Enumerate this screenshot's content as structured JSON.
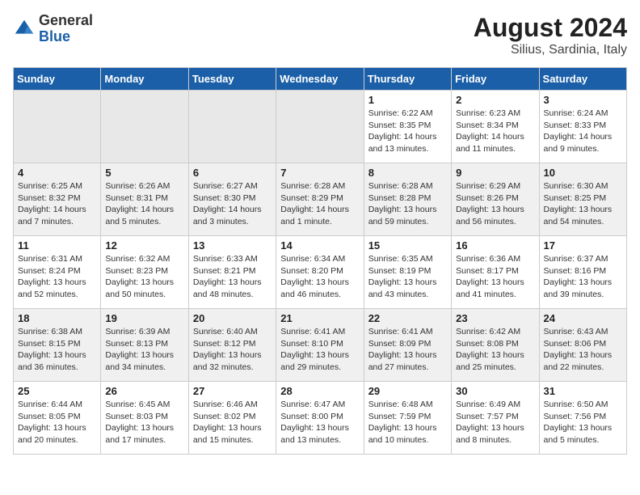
{
  "header": {
    "logo_general": "General",
    "logo_blue": "Blue",
    "month_year": "August 2024",
    "location": "Silius, Sardinia, Italy"
  },
  "weekdays": [
    "Sunday",
    "Monday",
    "Tuesday",
    "Wednesday",
    "Thursday",
    "Friday",
    "Saturday"
  ],
  "weeks": [
    [
      {
        "day": "",
        "info": ""
      },
      {
        "day": "",
        "info": ""
      },
      {
        "day": "",
        "info": ""
      },
      {
        "day": "",
        "info": ""
      },
      {
        "day": "1",
        "info": "Sunrise: 6:22 AM\nSunset: 8:35 PM\nDaylight: 14 hours\nand 13 minutes."
      },
      {
        "day": "2",
        "info": "Sunrise: 6:23 AM\nSunset: 8:34 PM\nDaylight: 14 hours\nand 11 minutes."
      },
      {
        "day": "3",
        "info": "Sunrise: 6:24 AM\nSunset: 8:33 PM\nDaylight: 14 hours\nand 9 minutes."
      }
    ],
    [
      {
        "day": "4",
        "info": "Sunrise: 6:25 AM\nSunset: 8:32 PM\nDaylight: 14 hours\nand 7 minutes."
      },
      {
        "day": "5",
        "info": "Sunrise: 6:26 AM\nSunset: 8:31 PM\nDaylight: 14 hours\nand 5 minutes."
      },
      {
        "day": "6",
        "info": "Sunrise: 6:27 AM\nSunset: 8:30 PM\nDaylight: 14 hours\nand 3 minutes."
      },
      {
        "day": "7",
        "info": "Sunrise: 6:28 AM\nSunset: 8:29 PM\nDaylight: 14 hours\nand 1 minute."
      },
      {
        "day": "8",
        "info": "Sunrise: 6:28 AM\nSunset: 8:28 PM\nDaylight: 13 hours\nand 59 minutes."
      },
      {
        "day": "9",
        "info": "Sunrise: 6:29 AM\nSunset: 8:26 PM\nDaylight: 13 hours\nand 56 minutes."
      },
      {
        "day": "10",
        "info": "Sunrise: 6:30 AM\nSunset: 8:25 PM\nDaylight: 13 hours\nand 54 minutes."
      }
    ],
    [
      {
        "day": "11",
        "info": "Sunrise: 6:31 AM\nSunset: 8:24 PM\nDaylight: 13 hours\nand 52 minutes."
      },
      {
        "day": "12",
        "info": "Sunrise: 6:32 AM\nSunset: 8:23 PM\nDaylight: 13 hours\nand 50 minutes."
      },
      {
        "day": "13",
        "info": "Sunrise: 6:33 AM\nSunset: 8:21 PM\nDaylight: 13 hours\nand 48 minutes."
      },
      {
        "day": "14",
        "info": "Sunrise: 6:34 AM\nSunset: 8:20 PM\nDaylight: 13 hours\nand 46 minutes."
      },
      {
        "day": "15",
        "info": "Sunrise: 6:35 AM\nSunset: 8:19 PM\nDaylight: 13 hours\nand 43 minutes."
      },
      {
        "day": "16",
        "info": "Sunrise: 6:36 AM\nSunset: 8:17 PM\nDaylight: 13 hours\nand 41 minutes."
      },
      {
        "day": "17",
        "info": "Sunrise: 6:37 AM\nSunset: 8:16 PM\nDaylight: 13 hours\nand 39 minutes."
      }
    ],
    [
      {
        "day": "18",
        "info": "Sunrise: 6:38 AM\nSunset: 8:15 PM\nDaylight: 13 hours\nand 36 minutes."
      },
      {
        "day": "19",
        "info": "Sunrise: 6:39 AM\nSunset: 8:13 PM\nDaylight: 13 hours\nand 34 minutes."
      },
      {
        "day": "20",
        "info": "Sunrise: 6:40 AM\nSunset: 8:12 PM\nDaylight: 13 hours\nand 32 minutes."
      },
      {
        "day": "21",
        "info": "Sunrise: 6:41 AM\nSunset: 8:10 PM\nDaylight: 13 hours\nand 29 minutes."
      },
      {
        "day": "22",
        "info": "Sunrise: 6:41 AM\nSunset: 8:09 PM\nDaylight: 13 hours\nand 27 minutes."
      },
      {
        "day": "23",
        "info": "Sunrise: 6:42 AM\nSunset: 8:08 PM\nDaylight: 13 hours\nand 25 minutes."
      },
      {
        "day": "24",
        "info": "Sunrise: 6:43 AM\nSunset: 8:06 PM\nDaylight: 13 hours\nand 22 minutes."
      }
    ],
    [
      {
        "day": "25",
        "info": "Sunrise: 6:44 AM\nSunset: 8:05 PM\nDaylight: 13 hours\nand 20 minutes."
      },
      {
        "day": "26",
        "info": "Sunrise: 6:45 AM\nSunset: 8:03 PM\nDaylight: 13 hours\nand 17 minutes."
      },
      {
        "day": "27",
        "info": "Sunrise: 6:46 AM\nSunset: 8:02 PM\nDaylight: 13 hours\nand 15 minutes."
      },
      {
        "day": "28",
        "info": "Sunrise: 6:47 AM\nSunset: 8:00 PM\nDaylight: 13 hours\nand 13 minutes."
      },
      {
        "day": "29",
        "info": "Sunrise: 6:48 AM\nSunset: 7:59 PM\nDaylight: 13 hours\nand 10 minutes."
      },
      {
        "day": "30",
        "info": "Sunrise: 6:49 AM\nSunset: 7:57 PM\nDaylight: 13 hours\nand 8 minutes."
      },
      {
        "day": "31",
        "info": "Sunrise: 6:50 AM\nSunset: 7:56 PM\nDaylight: 13 hours\nand 5 minutes."
      }
    ]
  ]
}
